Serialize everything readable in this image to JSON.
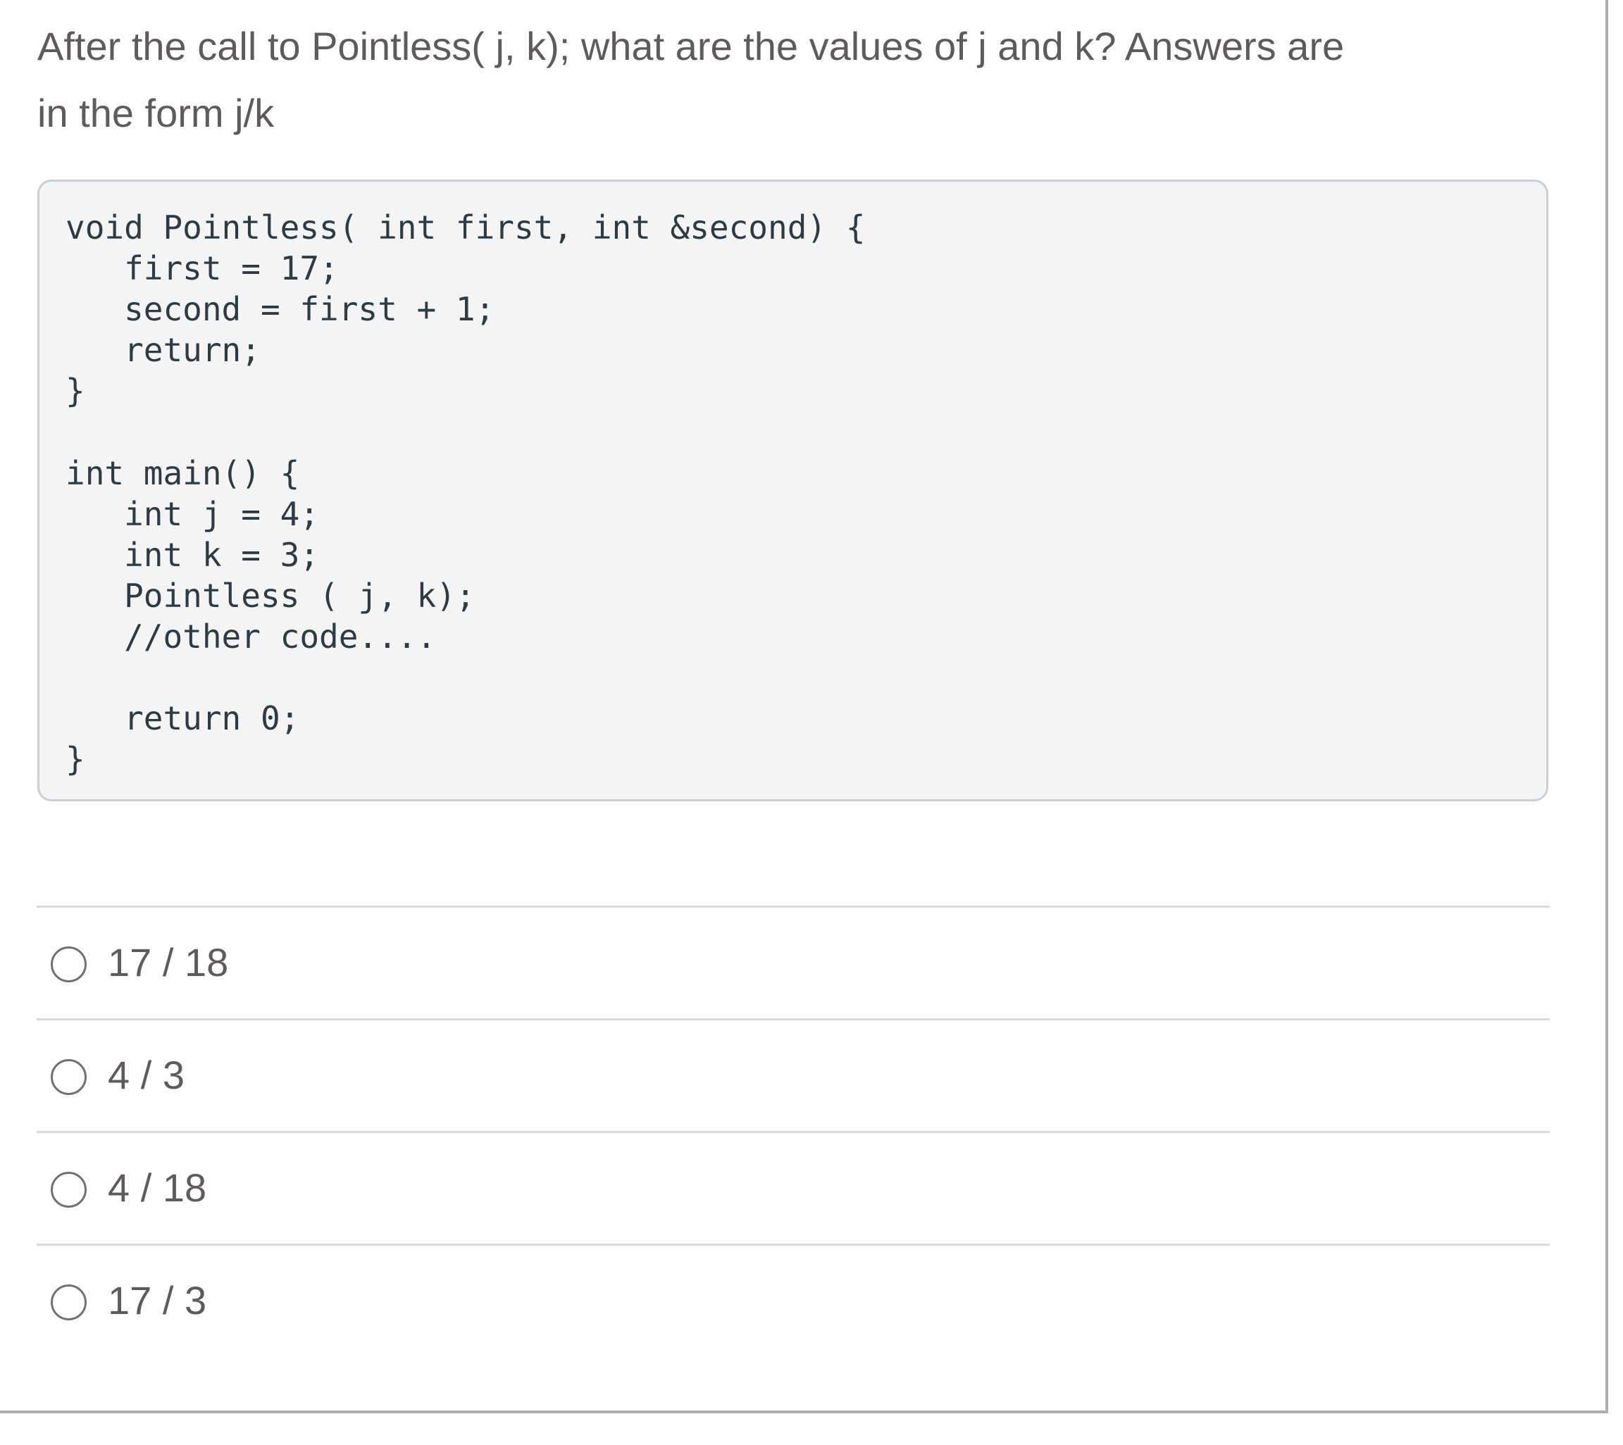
{
  "question": {
    "lines": [
      "After the call to Pointless( j, k); what are the values of j and k?  Answers are",
      "in the form j/k"
    ]
  },
  "code": {
    "language": "C++",
    "lines": [
      "void Pointless( int first, int &second) {",
      "   first = 17;",
      "   second = first + 1;",
      "   return;",
      "}",
      "",
      "int main() {",
      "   int j = 4;",
      "   int k = 3;",
      "   Pointless ( j, k);",
      "   //other code....",
      "",
      "   return 0;",
      "}"
    ]
  },
  "answers": [
    {
      "label": "17 / 18",
      "selected": false
    },
    {
      "label": "4 / 3",
      "selected": false
    },
    {
      "label": "4 / 18",
      "selected": false
    },
    {
      "label": "17 / 3",
      "selected": false
    }
  ],
  "colors": {
    "text": "#5f5a5e",
    "code_text": "#2d3b45",
    "code_background": "#f4f4f4",
    "code_border": "#c9cfd4",
    "separator": "#dadada",
    "radio_border": "#707070",
    "frame_border": "#aeaeae"
  }
}
